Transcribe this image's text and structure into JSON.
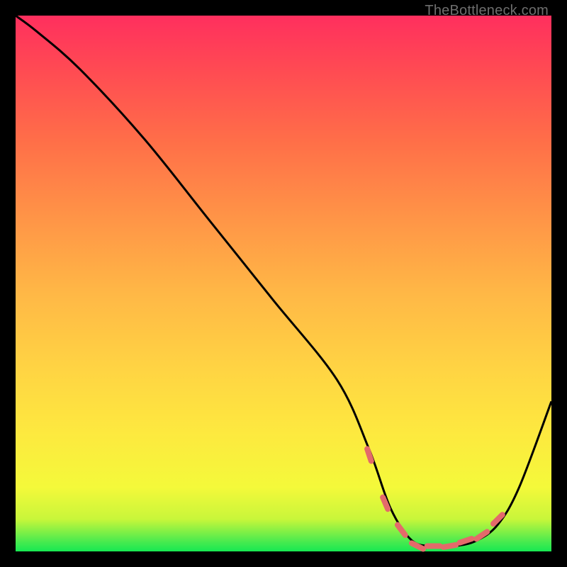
{
  "attribution": "TheBottleneck.com",
  "chart_data": {
    "type": "line",
    "title": "",
    "xlabel": "",
    "ylabel": "",
    "xlim": [
      0,
      100
    ],
    "ylim": [
      0,
      100
    ],
    "series": [
      {
        "name": "bottleneck-curve",
        "x": [
          0,
          4,
          12,
          24,
          36,
          48,
          60,
          66,
          70,
          74,
          78,
          82,
          86,
          90,
          94,
          100
        ],
        "values": [
          100,
          97,
          90,
          77,
          62,
          47,
          32,
          19,
          8,
          2,
          1,
          1,
          2,
          5,
          12,
          28
        ]
      }
    ],
    "markers": {
      "name": "highlight-dashes",
      "x": [
        66,
        69,
        72,
        75,
        78,
        81,
        84,
        87,
        90
      ],
      "values": [
        18,
        9,
        4,
        1,
        1,
        1,
        2,
        3,
        6
      ]
    },
    "colors": {
      "curve": "#000000",
      "markers": "#e46a6a",
      "gradient_top": "#ff2f5e",
      "gradient_bottom": "#17e852"
    }
  }
}
